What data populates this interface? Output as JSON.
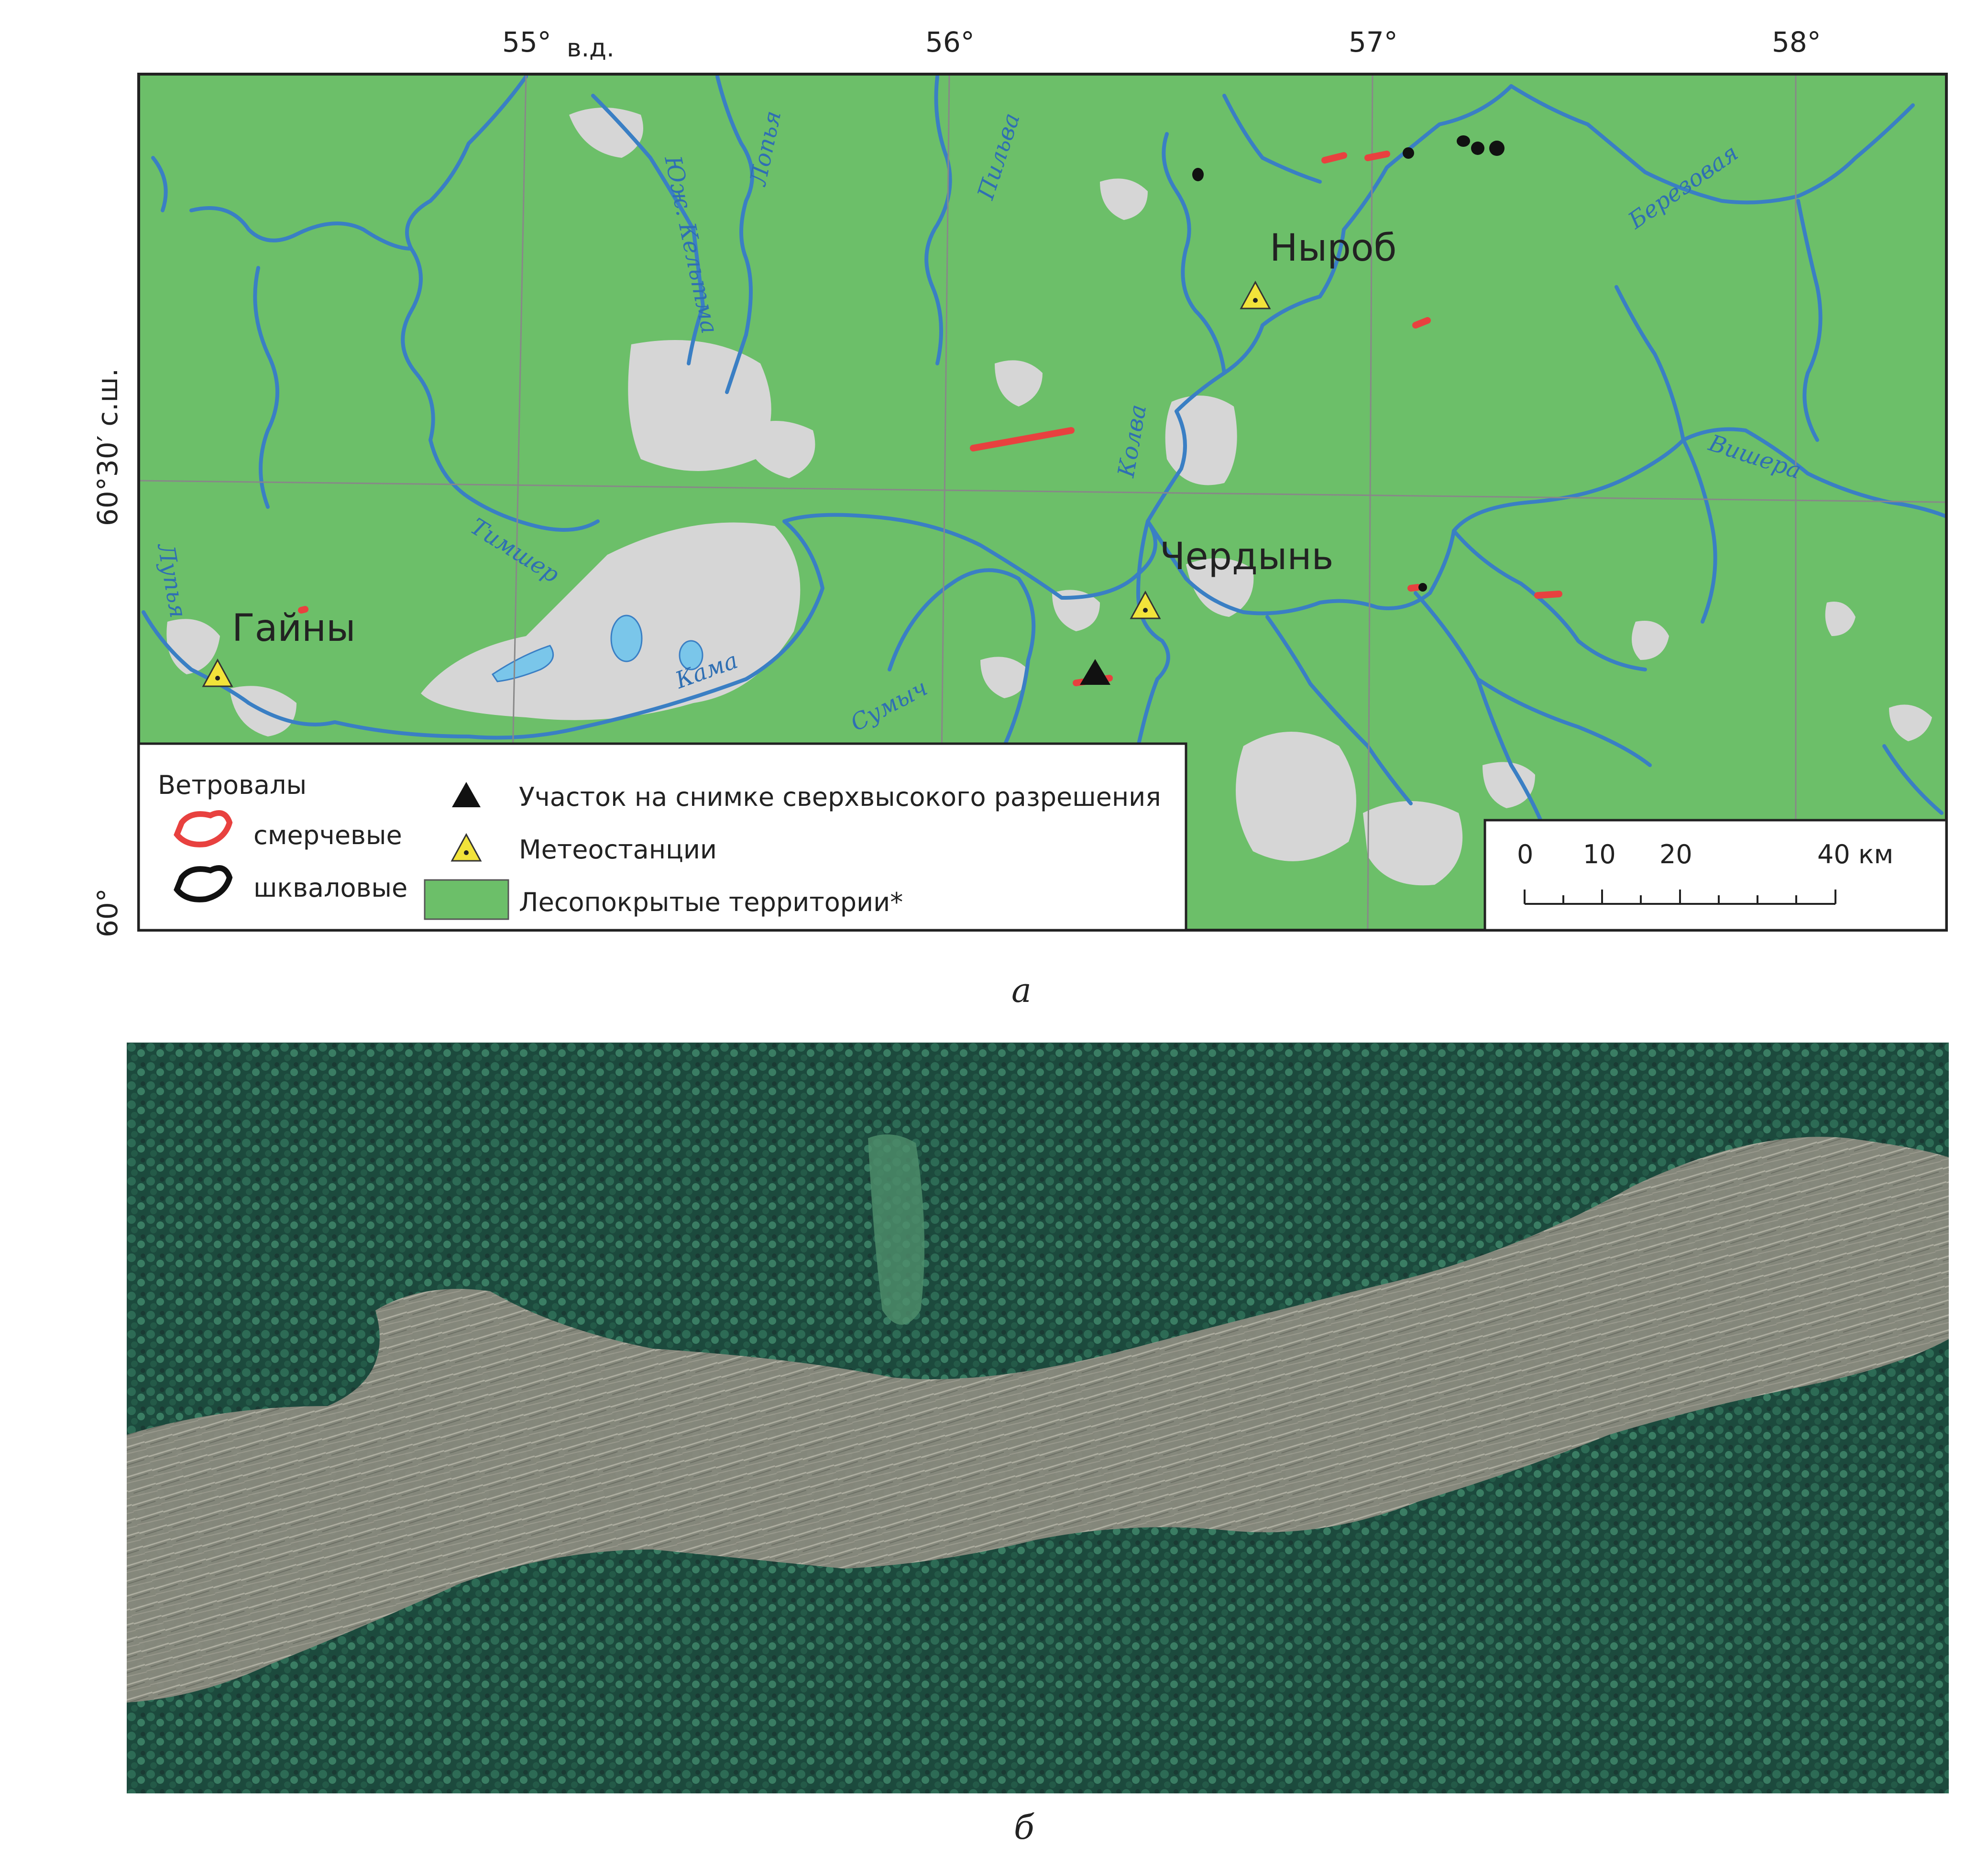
{
  "map": {
    "lon_labels": [
      {
        "text": "55°",
        "lon": 55
      },
      {
        "text": "56°",
        "lon": 56
      },
      {
        "text": "57°",
        "lon": 57
      },
      {
        "text": "58°",
        "lon": 58
      }
    ],
    "lon_unit": "в.д.",
    "lat_labels": [
      {
        "text": "60°30′ с.ш.",
        "lat": 60.5
      },
      {
        "text": "60°",
        "lat": 60
      }
    ],
    "towns": [
      {
        "name": "Гайны"
      },
      {
        "name": "Ныроб"
      },
      {
        "name": "Чердынь"
      }
    ],
    "rivers": [
      {
        "name": "Лопья"
      },
      {
        "name": "Юж. Кельтма"
      },
      {
        "name": "Пильва"
      },
      {
        "name": "Колва"
      },
      {
        "name": "Березовая"
      },
      {
        "name": "Вишера"
      },
      {
        "name": "Тимшер"
      },
      {
        "name": "Лупья"
      },
      {
        "name": "Кама"
      },
      {
        "name": "Сумыч"
      }
    ],
    "colors": {
      "forest": "#6cbf69",
      "nonforest": "#d4d4d4",
      "river": "#3a7fc4",
      "lake": "#79c5e8",
      "tornado": "#e8413f",
      "squall": "#111111",
      "station": "#f2e33a"
    }
  },
  "legend": {
    "title": "Ветровалы",
    "tornado_label": "смерчевые",
    "squall_label": "шкваловые",
    "site_label": "Участок на снимке сверхвысокого разрешения",
    "station_label": "Метеостанции",
    "forest_label": "Лесопокрытые территории*"
  },
  "scalebar": {
    "ticks": [
      "0",
      "10",
      "20",
      "40 км"
    ]
  },
  "panels": {
    "a": "а",
    "b": "б"
  },
  "photo": {
    "description_icon": "satellite-image"
  }
}
